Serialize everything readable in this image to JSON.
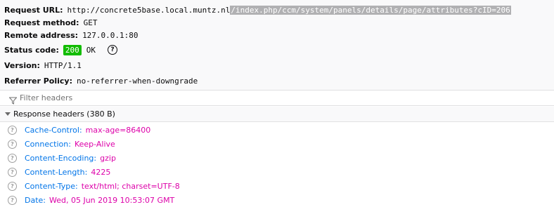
{
  "summary": {
    "request_url_label": "Request URL:",
    "request_url_base": "http://concrete5base.local.muntz.nl",
    "request_url_path": "/index.php/ccm/system/panels/details/page/attributes?cID=206",
    "request_method_label": "Request method:",
    "request_method": "GET",
    "remote_address_label": "Remote address:",
    "remote_address": "127.0.0.1:80",
    "status_code_label": "Status code:",
    "status_code": "200",
    "status_text": "OK",
    "version_label": "Version:",
    "version": "HTTP/1.1",
    "referrer_policy_label": "Referrer Policy:",
    "referrer_policy": "no-referrer-when-downgrade"
  },
  "filter": {
    "placeholder": "Filter headers",
    "icon": "funnel-icon"
  },
  "response_headers": {
    "title": "Response headers (380 B)",
    "rows": [
      {
        "name": "Cache-Control:",
        "value": "max-age=86400"
      },
      {
        "name": "Connection:",
        "value": "Keep-Alive"
      },
      {
        "name": "Content-Encoding:",
        "value": "gzip"
      },
      {
        "name": "Content-Length:",
        "value": "4225"
      },
      {
        "name": "Content-Type:",
        "value": "text/html; charset=UTF-8"
      },
      {
        "name": "Date:",
        "value": "Wed, 05 Jun 2019 10:53:07 GMT"
      }
    ]
  },
  "colors": {
    "status_badge": "#12bc00",
    "header_name": "#0074e8",
    "header_value": "#dd00a9"
  }
}
